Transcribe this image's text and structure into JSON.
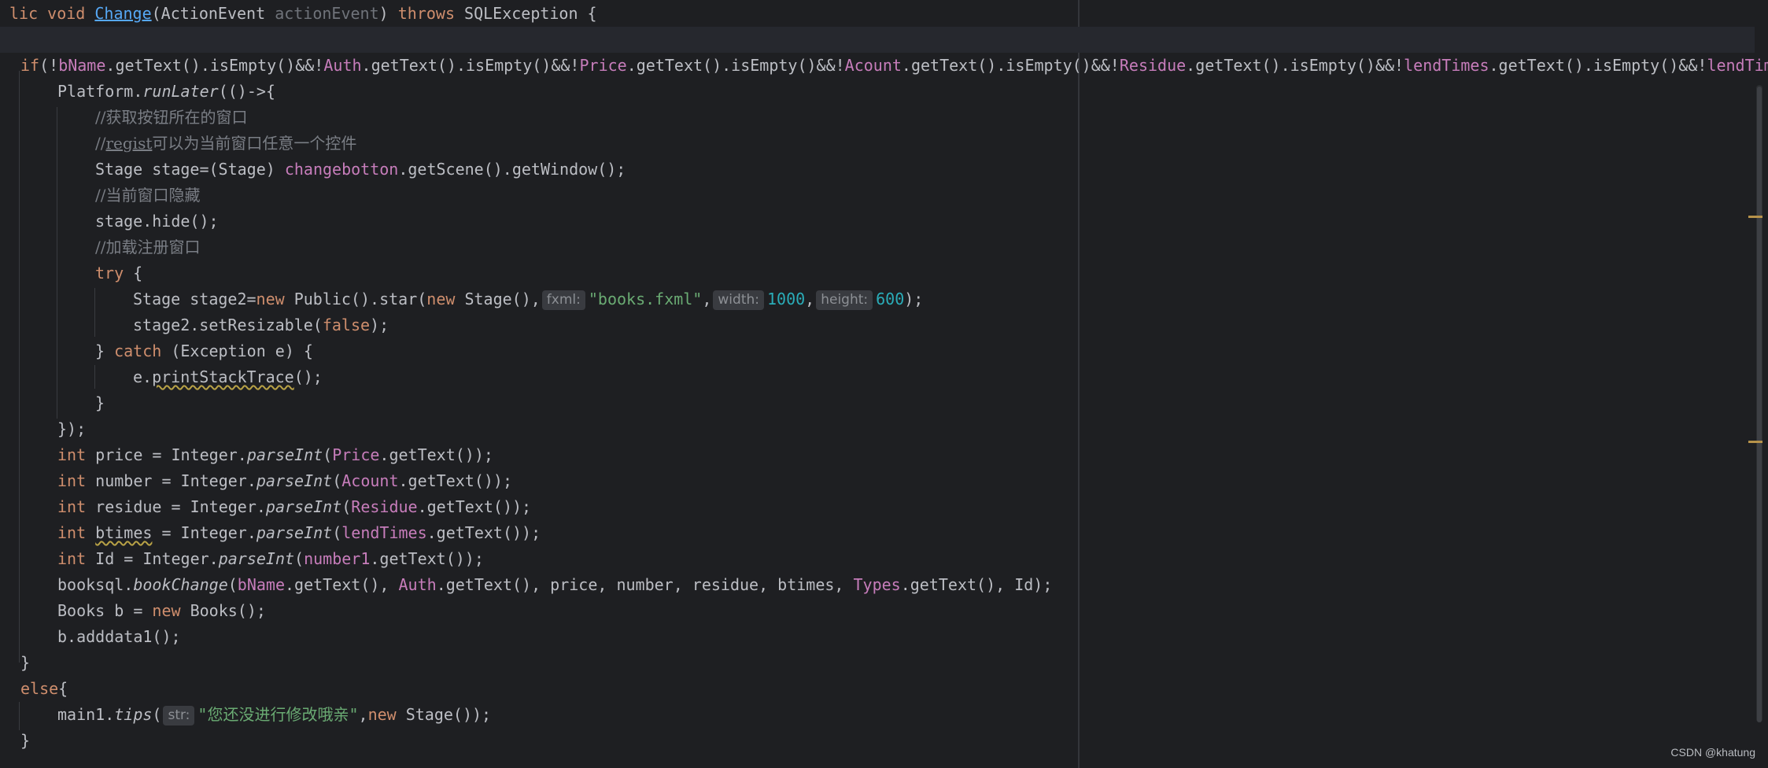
{
  "editor": {
    "signature": {
      "mod": "lic",
      "void": "void",
      "name": "Change",
      "open": "(ActionEvent ",
      "param": "actionEvent",
      "close": ") ",
      "throws": "throws",
      "ex": " SQLException {"
    },
    "if_line": {
      "t0": "if",
      "t1": "(!",
      "f1": "bName",
      "t2": ".getText().isEmpty()&&!",
      "f2": "Auth",
      "t3": ".getText().isEmpty()&&!",
      "f3": "Price",
      "t4": ".getText().isEmpty()&&!",
      "f4": "Acount",
      "t5": ".getText().isEmpty()&&!",
      "f5": "Residue",
      "t6": ".getText().isEmpty()&&!",
      "f6": "lendTimes",
      "t7": ".getText().isEmpty()&&!",
      "f7": "lendTim"
    },
    "runlater": {
      "obj": "Platform.",
      "method": "runLater",
      "rest": "(()->{"
    },
    "comment1": "//获取按钮所在的窗口",
    "comment2": {
      "slashes": "//",
      "word": "regist",
      "rest": "可以为当前窗口任意一个控件"
    },
    "stage_line": {
      "a": "Stage stage=(Stage) ",
      "field": "changebotton",
      "b": ".getScene().getWindow();"
    },
    "comment3": "//当前窗口隐藏",
    "hide_line": "stage.hide();",
    "comment4": "//加载注册窗口",
    "try_line": {
      "kw": "try",
      "rest": " {"
    },
    "star_line": {
      "a": "Stage stage2=",
      "new1": "new",
      "b": " Public().star(",
      "new2": "new",
      "c": " Stage(),",
      "hint1": "fxml:",
      "str": "\"books.fxml\"",
      "comma1": ",",
      "hint2": "width:",
      "num1": "1000",
      "comma2": ",",
      "hint3": "height:",
      "num2": "600",
      "end": ");"
    },
    "resizable_line": {
      "a": "stage2.setResizable(",
      "kw": "false",
      "b": ");"
    },
    "catch_line": {
      "a": "} ",
      "kw": "catch",
      "b": " (Exception e) {"
    },
    "print_line": {
      "a": "e.",
      "method": "printStackTrace",
      "b": "();"
    },
    "close_brace": "}",
    "close_lambda": "});",
    "int_lines": [
      {
        "kw": "int",
        "var": " price = Integer.",
        "method": "parseInt",
        "open": "(",
        "field": "Price",
        "end": ".getText());"
      },
      {
        "kw": "int",
        "var": " number = Integer.",
        "method": "parseInt",
        "open": "(",
        "field": "Acount",
        "end": ".getText());"
      },
      {
        "kw": "int",
        "var": " residue = Integer.",
        "method": "parseInt",
        "open": "(",
        "field": "Residue",
        "end": ".getText());"
      },
      {
        "kw": "int",
        "var_pre": " ",
        "var_warn": "btimes",
        "var": " = Integer.",
        "method": "parseInt",
        "open": "(",
        "field": "lendTimes",
        "end": ".getText());"
      },
      {
        "kw": "int",
        "var": " Id = Integer.",
        "method": "parseInt",
        "open": "(",
        "field": "number1",
        "end": ".getText());"
      }
    ],
    "booksql_line": {
      "a": "booksql.",
      "method": "bookChange",
      "b": "(",
      "f1": "bName",
      "c": ".getText(), ",
      "f2": "Auth",
      "d": ".getText(), price, number, residue, btimes, ",
      "f3": "Types",
      "e": ".getText(), Id);"
    },
    "books_line": {
      "a": "Books b = ",
      "kw": "new",
      "b": " Books();"
    },
    "adddata_line": "b.adddata1();",
    "else_line": {
      "kw": "else",
      "rest": "{"
    },
    "tips_line": {
      "a": "main1.",
      "method": "tips",
      "b": "(",
      "hint": "str:",
      "str": "\"您还没进行修改哦亲\"",
      "c": ",",
      "kw": "new",
      "d": " Stage());"
    }
  },
  "watermark": "CSDN @khatung",
  "colors": {
    "background": "#1e1f22",
    "keyword": "#cf8e6d",
    "field": "#c77dbb",
    "string": "#6aab73",
    "number": "#2aacb8",
    "comment": "#7a7e85",
    "declaration": "#56a8f5"
  }
}
